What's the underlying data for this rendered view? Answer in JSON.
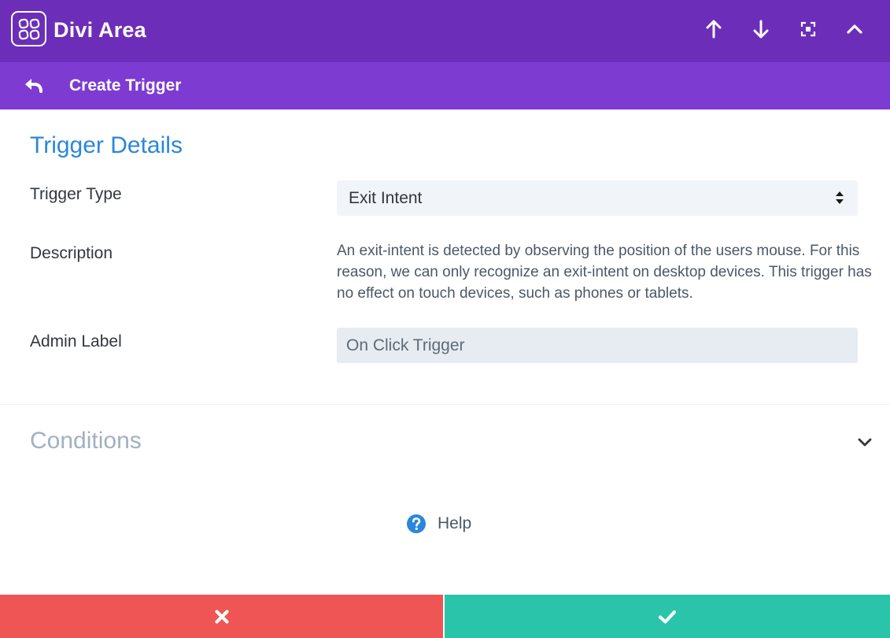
{
  "header": {
    "title": "Divi Area",
    "icons": [
      "divi-area-logo-icon",
      "arrow-up-icon",
      "arrow-down-icon",
      "fullscreen-icon",
      "collapse-icon"
    ]
  },
  "subheader": {
    "title": "Create Trigger",
    "icon": "back-arrow-icon"
  },
  "trigger_details": {
    "section_title": "Trigger Details",
    "trigger_type_label": "Trigger Type",
    "trigger_type_value": "Exit Intent",
    "description_label": "Description",
    "description_text": "An exit-intent is detected by observing the position of the users mouse. For this reason, we can only recognize an exit-intent on desktop devices. This trigger has no effect on touch devices, such as phones or tablets.",
    "admin_label_label": "Admin Label",
    "admin_label_value": "On Click Trigger"
  },
  "conditions": {
    "section_title": "Conditions",
    "expanded": false
  },
  "help": {
    "label": "Help",
    "icon": "help-icon"
  },
  "footer": {
    "cancel_icon": "close-icon",
    "save_icon": "check-icon"
  },
  "colors": {
    "header_bg": "#6c2eb9",
    "subheader_bg": "#7d3bd2",
    "accent_blue": "#2b87da",
    "cancel_red": "#ef5555",
    "save_green": "#29c4a9"
  }
}
